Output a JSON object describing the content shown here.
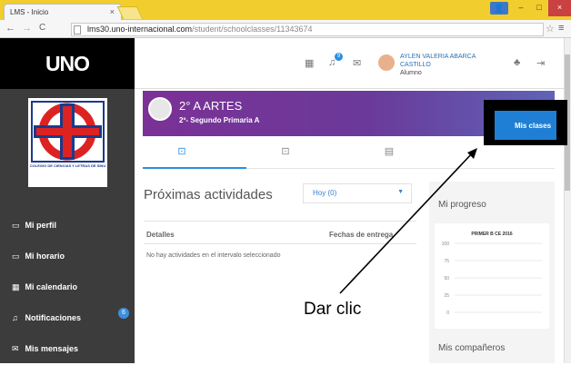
{
  "browser": {
    "tab_title": "LMS - Inicio",
    "tab_close": "×",
    "url_host": "lms30.uno-internacional.com",
    "url_path": "/student/schoolclasses/11343674",
    "back": "←",
    "forward": "→",
    "reload": "C",
    "star": "☆",
    "menu": "≡",
    "minimize": "–",
    "maximize": "□",
    "close": "×",
    "user": "👤"
  },
  "app": {
    "logo": "UNO",
    "school_caption": "COLEGIO DE CIENCIAS Y LETRAS DE SINU",
    "nav": [
      {
        "icon": "▭",
        "label": "Mi perfil"
      },
      {
        "icon": "▭",
        "label": "Mi horario"
      },
      {
        "icon": "▦",
        "label": "Mi calendario"
      },
      {
        "icon": "♫",
        "label": "Notificaciones"
      },
      {
        "icon": "✉",
        "label": "Mis mensajes"
      }
    ],
    "notification_count": "6"
  },
  "header": {
    "user_name": "AYLEN VALERIA ABARCA CASTILLO",
    "role": "Alumno",
    "notif_badge": "9"
  },
  "class": {
    "title": "2° A ARTES",
    "subtitle": "2º- Segundo Primaria A",
    "mis_clases": "Mis clases"
  },
  "activities": {
    "title": "Próximas actividades",
    "filter": "Hoy (0)",
    "col_details": "Detalles",
    "col_due": "Fechas de entrega",
    "empty": "No hay actividades en el intervalo seleccionado"
  },
  "progress": {
    "title": "Mi progreso",
    "companions": "Mis compañeros"
  },
  "chart_data": {
    "type": "bar",
    "title": "PRIMER B CE 2016",
    "categories": [],
    "values": [],
    "yticks": [
      100,
      75,
      50,
      25,
      0
    ],
    "ylim": [
      0,
      100
    ],
    "grid": true
  },
  "annotation": {
    "text": "Dar clic"
  },
  "colors": {
    "banner": "#7b3196",
    "accent": "#1e7fd4",
    "sidebar": "#3c3c3c",
    "tabbar": "#f1cd2e"
  }
}
